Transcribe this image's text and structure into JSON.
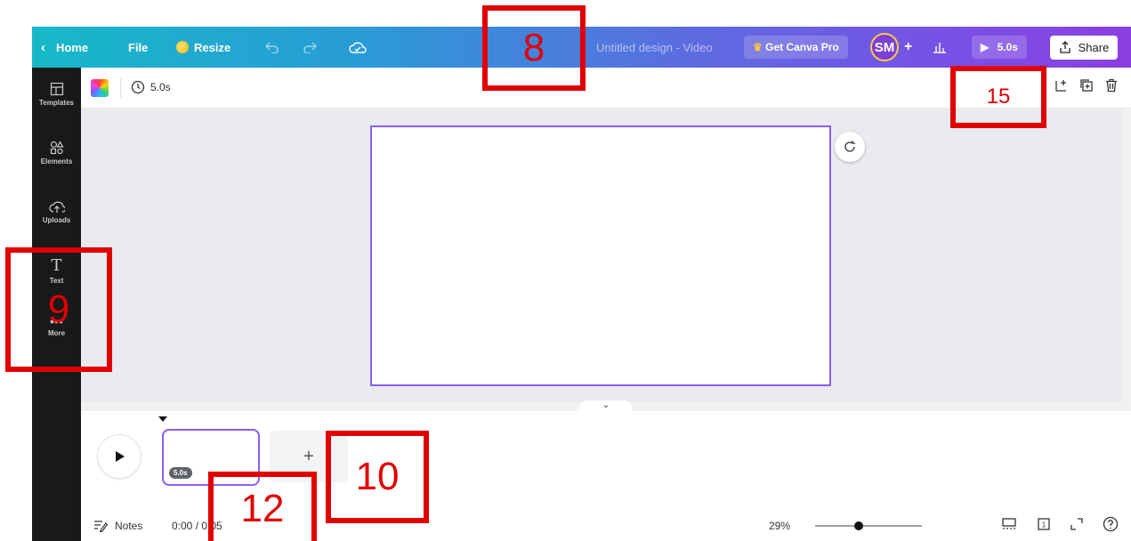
{
  "topbar": {
    "home_label": "Home",
    "file_label": "File",
    "resize_label": "Resize",
    "title": "Untitled design - Video",
    "pro_label": "Get Canva Pro",
    "avatar_initials": "SM",
    "play_label": "5.0s",
    "share_label": "Share"
  },
  "sidebar": {
    "items": [
      {
        "label": "Templates",
        "icon": "templates-icon"
      },
      {
        "label": "Elements",
        "icon": "elements-icon"
      },
      {
        "label": "Uploads",
        "icon": "uploads-icon"
      },
      {
        "label": "Text",
        "icon": "text-icon"
      },
      {
        "label": "More",
        "icon": "more-icon"
      }
    ]
  },
  "toolbar": {
    "duration": "5.0s"
  },
  "timeline": {
    "clip_duration": "5.0s",
    "add_label": "+"
  },
  "bottombar": {
    "notes_label": "Notes",
    "time": "0:00 / 0:05",
    "zoom": "29%"
  },
  "annotations": [
    {
      "label": "8"
    },
    {
      "label": "9"
    },
    {
      "label": "10"
    },
    {
      "label": "12"
    },
    {
      "label": "15"
    }
  ],
  "colors": {
    "gradient_start": "#17b9c8",
    "gradient_end": "#8b3fe0",
    "accent": "#8b5cf6",
    "annotation": "#e10000",
    "sidebar_bg": "#18191b"
  }
}
